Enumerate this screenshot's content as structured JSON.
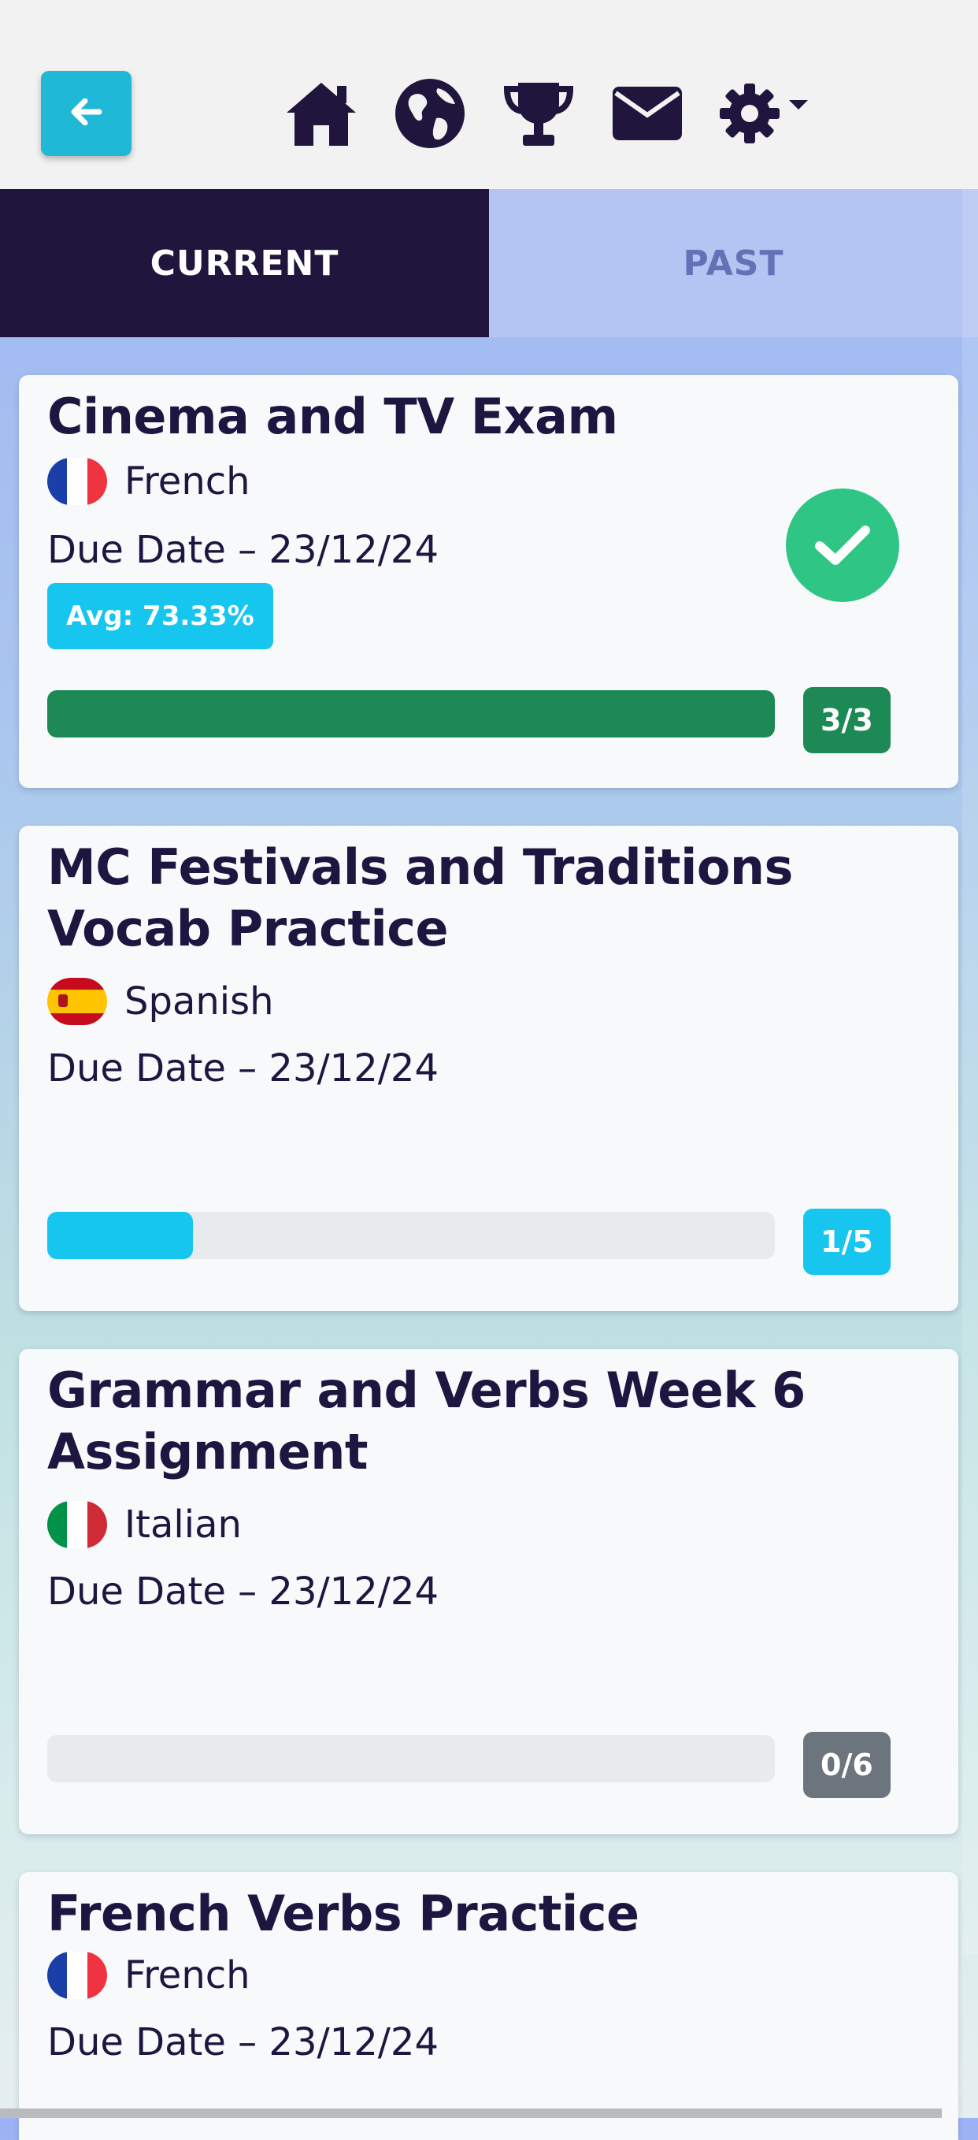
{
  "colors": {
    "nav_dark": "#20163d",
    "accent_cyan": "#17c6ef",
    "success_green": "#1d8a56",
    "check_green": "#2ec585",
    "neutral_gray": "#6c757d",
    "track_gray": "#e8ebed"
  },
  "nav": {
    "back_icon": "arrow-left-icon",
    "icons": [
      "home-icon",
      "globe-icon",
      "trophy-icon",
      "envelope-icon",
      "gear-icon"
    ]
  },
  "tabs": {
    "current": "CURRENT",
    "past": "PAST"
  },
  "assignments": [
    {
      "title": "Cinema and TV Exam",
      "language": "French",
      "flag": "france",
      "due": "Due Date – 23/12/24",
      "avg": "Avg: 73.33%",
      "completed": true,
      "progress_fraction": 1.0,
      "count": "3/3",
      "count_color": "#1d8a56"
    },
    {
      "title": "MC Festivals and Traditions Vocab Practice",
      "language": "Spanish",
      "flag": "spain",
      "due": "Due Date – 23/12/24",
      "progress_fraction": 0.2,
      "count": "1/5",
      "count_color": "#17c6ef"
    },
    {
      "title": "Grammar and Verbs Week 6 Assignment",
      "language": "Italian",
      "flag": "italy",
      "due": "Due Date – 23/12/24",
      "progress_fraction": 0.0,
      "count": "0/6",
      "count_color": "#6c757d"
    },
    {
      "title": "French Verbs Practice",
      "language": "French",
      "flag": "france",
      "due": "Due Date – 23/12/24"
    }
  ]
}
